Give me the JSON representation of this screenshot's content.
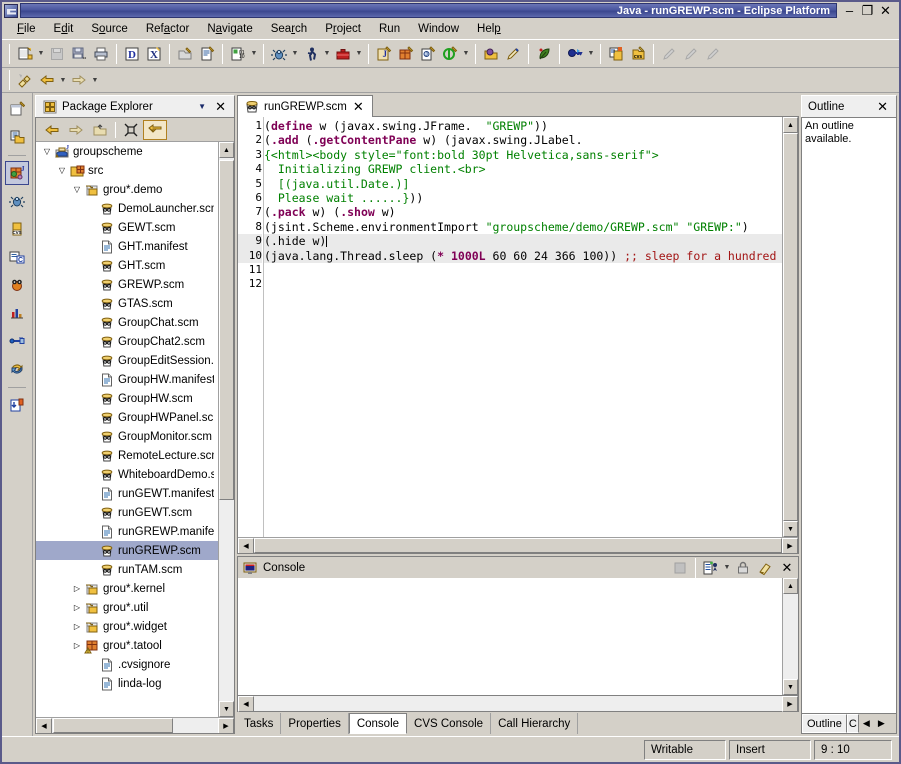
{
  "window": {
    "title": "Java - runGREWP.scm - Eclipse Platform",
    "minimize_label": "–",
    "maximize_label": "❐",
    "close_label": "✕"
  },
  "menubar": {
    "items": [
      {
        "label": "File",
        "mnemonic_index": 0
      },
      {
        "label": "Edit",
        "mnemonic_index": 1
      },
      {
        "label": "Source",
        "mnemonic_index": 1
      },
      {
        "label": "Refactor",
        "mnemonic_index": 3
      },
      {
        "label": "Navigate",
        "mnemonic_index": 1
      },
      {
        "label": "Search",
        "mnemonic_index": 3
      },
      {
        "label": "Project",
        "mnemonic_index": 1
      },
      {
        "label": "Run",
        "mnemonic_index": -1
      },
      {
        "label": "Window",
        "mnemonic_index": -1
      },
      {
        "label": "Help",
        "mnemonic_index": 3
      }
    ]
  },
  "toolbar": {
    "groups": [
      {
        "buttons": [
          {
            "name": "new-wizard",
            "icon": "new-file-icon",
            "dropdown": true
          },
          {
            "name": "save",
            "icon": "save-disabled-icon",
            "dropdown": false
          },
          {
            "name": "save-all",
            "icon": "save-all-icon",
            "dropdown": false
          },
          {
            "name": "print",
            "icon": "print-icon",
            "dropdown": false
          }
        ]
      },
      {
        "buttons": [
          {
            "name": "new-javadoc",
            "icon": "javadoc-icon",
            "dropdown": false
          },
          {
            "name": "new-xdoclet",
            "icon": "xdoclet-icon",
            "dropdown": false
          }
        ]
      },
      {
        "buttons": [
          {
            "name": "open-type",
            "icon": "open-type-icon",
            "dropdown": false
          },
          {
            "name": "open-resource",
            "icon": "open-resource-icon",
            "dropdown": false
          }
        ]
      },
      {
        "buttons": [
          {
            "name": "external-tools",
            "icon": "external-tools-icon",
            "dropdown": true
          }
        ]
      },
      {
        "buttons": [
          {
            "name": "debug",
            "icon": "debug-bug-icon",
            "dropdown": true
          },
          {
            "name": "run",
            "icon": "run-man-icon",
            "dropdown": true
          },
          {
            "name": "run-external",
            "icon": "run-toolbox-icon",
            "dropdown": true
          }
        ]
      },
      {
        "buttons": [
          {
            "name": "new-java-project",
            "icon": "new-java-project-icon",
            "dropdown": false
          },
          {
            "name": "new-package",
            "icon": "new-package-icon",
            "dropdown": false
          },
          {
            "name": "new-java-class",
            "icon": "new-class-icon",
            "dropdown": false
          },
          {
            "name": "new-interface",
            "icon": "new-interface-icon",
            "dropdown": true
          }
        ]
      },
      {
        "buttons": [
          {
            "name": "open-perspective",
            "icon": "open-perspective-icon",
            "dropdown": false
          },
          {
            "name": "customize-perspective",
            "icon": "pencil-icon",
            "dropdown": false
          }
        ]
      },
      {
        "buttons": [
          {
            "name": "annotation",
            "icon": "leaf-icon",
            "dropdown": false
          }
        ]
      },
      {
        "buttons": [
          {
            "name": "search",
            "icon": "search-key-icon",
            "dropdown": true
          }
        ]
      },
      {
        "buttons": [
          {
            "name": "synchronize",
            "icon": "synchronize-icon",
            "dropdown": false
          },
          {
            "name": "cvs-commit",
            "icon": "cvs-icon",
            "dropdown": false
          }
        ]
      },
      {
        "buttons": [
          {
            "name": "previous-edit",
            "icon": "prev-edit-disabled-icon",
            "dropdown": false
          },
          {
            "name": "next-edit",
            "icon": "next-edit-disabled-icon",
            "dropdown": false
          },
          {
            "name": "last-edit",
            "icon": "last-edit-disabled-icon",
            "dropdown": false
          }
        ]
      }
    ],
    "row2": [
      {
        "name": "toggle-mark-occurrences",
        "icon": "mark-occurrences-icon",
        "dropdown": false
      },
      {
        "name": "back",
        "icon": "back-arrow-icon",
        "dropdown": true
      },
      {
        "name": "forward",
        "icon": "forward-arrow-icon",
        "dropdown": true
      }
    ]
  },
  "fastview": {
    "items": [
      {
        "name": "new-project",
        "icon": "new-project-icon",
        "selected": false
      },
      {
        "name": "resource-perspective",
        "icon": "resource-perspective-icon",
        "selected": false
      },
      {
        "name": "java-perspective",
        "icon": "java-perspective-icon",
        "selected": true
      },
      {
        "name": "debug-perspective",
        "icon": "debug-perspective-icon",
        "selected": false
      },
      {
        "name": "cvs-repository-perspective",
        "icon": "cvs-perspective-icon",
        "selected": false
      },
      {
        "name": "c-perspective",
        "icon": "c-perspective-icon",
        "selected": false
      },
      {
        "name": "jython-perspective",
        "icon": "jython-perspective-icon",
        "selected": false
      },
      {
        "name": "profiling-perspective",
        "icon": "profiling-perspective-icon",
        "selected": false
      },
      {
        "name": "plugin-perspective",
        "icon": "plugin-perspective-icon",
        "selected": false
      },
      {
        "name": "team-sync-perspective",
        "icon": "team-sync-perspective-icon",
        "selected": false
      },
      {
        "name": "install-perspective",
        "icon": "install-perspective-icon",
        "selected": false
      }
    ]
  },
  "package_explorer": {
    "title": "Package Explorer",
    "icon": "package-explorer-icon",
    "menu_label": "▼",
    "close_label": "✕",
    "toolbar": [
      {
        "name": "back",
        "icon": "back-arrow-icon",
        "selected": false
      },
      {
        "name": "forward",
        "icon": "forward-arrow-icon",
        "selected": false
      },
      {
        "name": "go-into",
        "icon": "go-up-icon",
        "selected": false
      },
      {
        "name": "collapse-all",
        "icon": "collapse-all-icon",
        "selected": false
      },
      {
        "name": "link-with-editor",
        "icon": "link-editor-icon",
        "selected": true
      }
    ],
    "tree": [
      {
        "label": "groupscheme",
        "indent": 0,
        "twisty": "open",
        "icon": "java-project-icon",
        "selected": false
      },
      {
        "label": "src",
        "indent": 1,
        "twisty": "open",
        "icon": "source-folder-icon",
        "selected": false
      },
      {
        "label": "grou*.demo",
        "indent": 2,
        "twisty": "open",
        "icon": "package-icon",
        "selected": false
      },
      {
        "label": "DemoLauncher.scm",
        "indent": 3,
        "twisty": "none",
        "icon": "scheme-file-icon",
        "selected": false
      },
      {
        "label": "GEWT.scm",
        "indent": 3,
        "twisty": "none",
        "icon": "scheme-file-icon",
        "selected": false
      },
      {
        "label": "GHT.manifest",
        "indent": 3,
        "twisty": "none",
        "icon": "text-file-icon",
        "selected": false
      },
      {
        "label": "GHT.scm",
        "indent": 3,
        "twisty": "none",
        "icon": "scheme-file-icon",
        "selected": false
      },
      {
        "label": "GREWP.scm",
        "indent": 3,
        "twisty": "none",
        "icon": "scheme-file-icon",
        "selected": false
      },
      {
        "label": "GTAS.scm",
        "indent": 3,
        "twisty": "none",
        "icon": "scheme-file-icon",
        "selected": false
      },
      {
        "label": "GroupChat.scm",
        "indent": 3,
        "twisty": "none",
        "icon": "scheme-file-icon",
        "selected": false
      },
      {
        "label": "GroupChat2.scm",
        "indent": 3,
        "twisty": "none",
        "icon": "scheme-file-icon",
        "selected": false
      },
      {
        "label": "GroupEditSession.scm",
        "indent": 3,
        "twisty": "none",
        "icon": "scheme-file-icon",
        "selected": false
      },
      {
        "label": "GroupHW.manifest",
        "indent": 3,
        "twisty": "none",
        "icon": "text-file-icon",
        "selected": false
      },
      {
        "label": "GroupHW.scm",
        "indent": 3,
        "twisty": "none",
        "icon": "scheme-file-icon",
        "selected": false
      },
      {
        "label": "GroupHWPanel.scm",
        "indent": 3,
        "twisty": "none",
        "icon": "scheme-file-icon",
        "selected": false
      },
      {
        "label": "GroupMonitor.scm",
        "indent": 3,
        "twisty": "none",
        "icon": "scheme-file-icon",
        "selected": false
      },
      {
        "label": "RemoteLecture.scm",
        "indent": 3,
        "twisty": "none",
        "icon": "scheme-file-icon",
        "selected": false
      },
      {
        "label": "WhiteboardDemo.scm",
        "indent": 3,
        "twisty": "none",
        "icon": "scheme-file-icon",
        "selected": false
      },
      {
        "label": "runGEWT.manifest",
        "indent": 3,
        "twisty": "none",
        "icon": "text-file-icon",
        "selected": false
      },
      {
        "label": "runGEWT.scm",
        "indent": 3,
        "twisty": "none",
        "icon": "scheme-file-icon",
        "selected": false
      },
      {
        "label": "runGREWP.manifest",
        "indent": 3,
        "twisty": "none",
        "icon": "text-file-icon",
        "selected": false
      },
      {
        "label": "runGREWP.scm",
        "indent": 3,
        "twisty": "none",
        "icon": "scheme-file-icon",
        "selected": true
      },
      {
        "label": "runTAM.scm",
        "indent": 3,
        "twisty": "none",
        "icon": "scheme-file-icon",
        "selected": false
      },
      {
        "label": "grou*.kernel",
        "indent": 2,
        "twisty": "closed",
        "icon": "package-icon",
        "selected": false
      },
      {
        "label": "grou*.util",
        "indent": 2,
        "twisty": "closed",
        "icon": "package-icon",
        "selected": false
      },
      {
        "label": "grou*.widget",
        "indent": 2,
        "twisty": "closed",
        "icon": "package-icon",
        "selected": false
      },
      {
        "label": "grou*.tatool",
        "indent": 2,
        "twisty": "closed",
        "icon": "package-warning-icon",
        "selected": false
      },
      {
        "label": ".cvsignore",
        "indent": 3,
        "twisty": "none",
        "icon": "text-file-icon",
        "selected": false
      },
      {
        "label": "linda-log",
        "indent": 3,
        "twisty": "none",
        "icon": "text-file-icon",
        "selected": false
      }
    ]
  },
  "editor": {
    "tab_label": "runGREWP.scm",
    "tab_icon": "scheme-file-icon",
    "close_label": "✕",
    "lines": [
      {
        "n": "1",
        "highlight": false,
        "tokens": [
          {
            "t": "(",
            "c": ""
          },
          {
            "t": "define",
            "c": "kw"
          },
          {
            "t": " w (javax.swing.JFrame.  ",
            "c": ""
          },
          {
            "t": "\"GREWP\"",
            "c": "str"
          },
          {
            "t": "))",
            "c": ""
          }
        ]
      },
      {
        "n": "2",
        "highlight": false,
        "tokens": [
          {
            "t": "(",
            "c": ""
          },
          {
            "t": ".add",
            "c": "kw"
          },
          {
            "t": " (",
            "c": ""
          },
          {
            "t": ".getContentPane",
            "c": "kw"
          },
          {
            "t": " w) (javax.swing.JLabel.",
            "c": ""
          }
        ]
      },
      {
        "n": "3",
        "highlight": false,
        "tokens": [
          {
            "t": "{<html><body style=",
            "c": "str"
          },
          {
            "t": "\"font:bold 30pt Helvetica,sans-serif\"",
            "c": "str"
          },
          {
            "t": ">",
            "c": "str"
          }
        ]
      },
      {
        "n": "4",
        "highlight": false,
        "tokens": [
          {
            "t": "  Initializing GREWP client.<br>",
            "c": "str"
          }
        ]
      },
      {
        "n": "5",
        "highlight": false,
        "tokens": [
          {
            "t": "  [(java.util.Date.)]",
            "c": "str"
          }
        ]
      },
      {
        "n": "6",
        "highlight": false,
        "tokens": [
          {
            "t": "  Please wait ......}",
            "c": "str"
          },
          {
            "t": "))",
            "c": ""
          }
        ]
      },
      {
        "n": "7",
        "highlight": false,
        "tokens": [
          {
            "t": "(",
            "c": ""
          },
          {
            "t": ".pack",
            "c": "kw"
          },
          {
            "t": " w) (",
            "c": ""
          },
          {
            "t": ".show",
            "c": "kw"
          },
          {
            "t": " w)",
            "c": ""
          }
        ]
      },
      {
        "n": "8",
        "highlight": false,
        "tokens": [
          {
            "t": "(jsint.Scheme.environmentImport ",
            "c": ""
          },
          {
            "t": "\"groupscheme/demo/GREWP.scm\"",
            "c": "str"
          },
          {
            "t": " ",
            "c": ""
          },
          {
            "t": "\"GREWP:\"",
            "c": "str"
          },
          {
            "t": ")",
            "c": ""
          }
        ]
      },
      {
        "n": "9",
        "highlight": true,
        "tokens": [
          {
            "t": "(.hide w)",
            "c": ""
          },
          {
            "t": "|caret|",
            "c": "caret"
          }
        ]
      },
      {
        "n": "10",
        "highlight": true,
        "tokens": [
          {
            "t": "(java.lang.Thread.sleep (",
            "c": ""
          },
          {
            "t": "*",
            "c": "kw"
          },
          {
            "t": " ",
            "c": ""
          },
          {
            "t": "1000L",
            "c": "num"
          },
          {
            "t": " 60 60 24 366 100)) ",
            "c": ""
          },
          {
            "t": ";; sleep for a hundred years!",
            "c": "cmt"
          }
        ]
      },
      {
        "n": "11",
        "highlight": false,
        "tokens": [
          {
            "t": "",
            "c": ""
          }
        ]
      },
      {
        "n": "12",
        "highlight": false,
        "tokens": [
          {
            "t": "",
            "c": ""
          }
        ]
      }
    ]
  },
  "outline": {
    "title": "Outline",
    "close_label": "✕",
    "message": "An outline available.",
    "tabs": [
      {
        "label": "Outline",
        "active": true
      },
      {
        "label": "C",
        "active": false
      }
    ],
    "nav_prev": "◀",
    "nav_next": "▶"
  },
  "console": {
    "title": "Console",
    "icon": "console-icon",
    "content": "",
    "toolbar": [
      {
        "name": "terminate",
        "icon": "terminate-disabled-icon"
      },
      {
        "name": "display-selected-console",
        "icon": "display-console-icon",
        "dropdown": true
      },
      {
        "name": "scroll-lock",
        "icon": "lock-icon"
      },
      {
        "name": "clear-console",
        "icon": "clear-console-icon"
      },
      {
        "name": "close-console",
        "icon": "close-icon"
      }
    ],
    "tabs": [
      {
        "label": "Tasks",
        "active": false
      },
      {
        "label": "Properties",
        "active": false
      },
      {
        "label": "Console",
        "active": true
      },
      {
        "label": "CVS Console",
        "active": false
      },
      {
        "label": "Call Hierarchy",
        "active": false
      }
    ]
  },
  "statusbar": {
    "writable": "Writable",
    "insert_mode": "Insert",
    "position": "9 : 10"
  },
  "colors": {
    "title_gradient_start": "#6a75b5",
    "title_gradient_end": "#3b478f",
    "chrome": "#d4d0c8",
    "selection": "#9fa8ca",
    "keyword": "#7f0055",
    "string": "#008000",
    "comment": "#a31515",
    "line_highlight": "#eaeaea"
  }
}
